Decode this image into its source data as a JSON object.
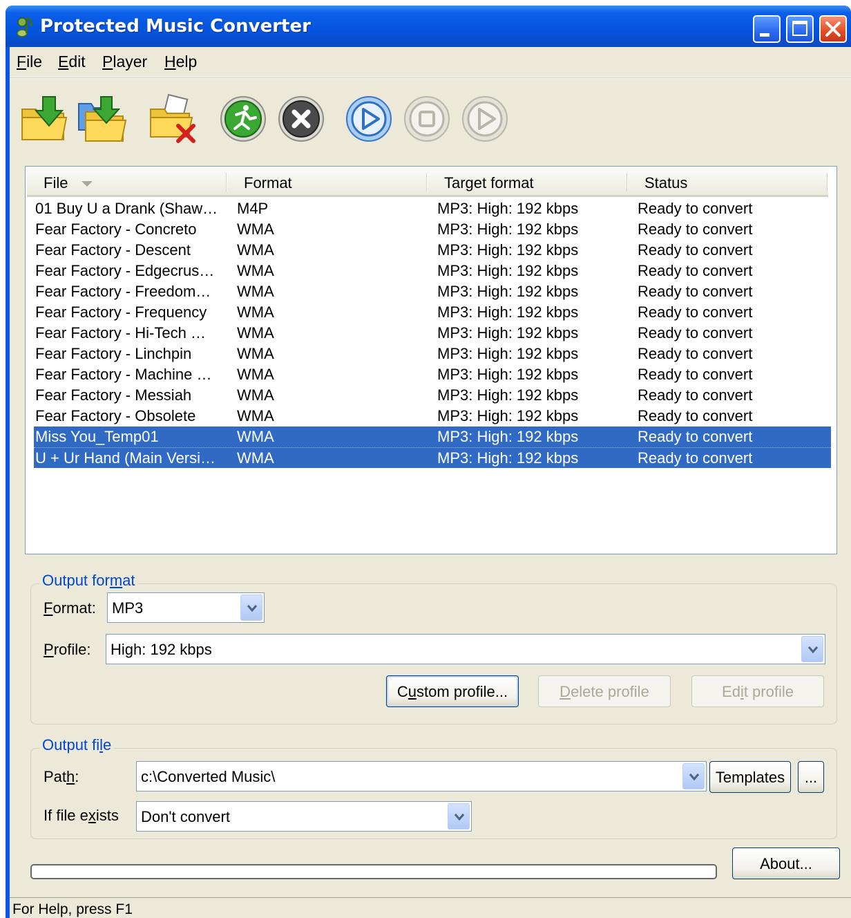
{
  "window": {
    "title": "Protected Music Converter"
  },
  "menu": [
    {
      "mnemonic": "F",
      "rest": "ile"
    },
    {
      "mnemonic": "E",
      "rest": "dit"
    },
    {
      "mnemonic": "P",
      "rest": "layer"
    },
    {
      "mnemonic": "H",
      "rest": "elp"
    }
  ],
  "toolbar": {
    "icons": [
      "add-files-icon",
      "add-folder-icon",
      "remove-files-icon",
      "convert-icon",
      "stop-convert-icon",
      "play-icon",
      "stop-icon",
      "next-icon"
    ]
  },
  "list": {
    "columns": [
      "File",
      "Format",
      "Target format",
      "Status"
    ],
    "rows": [
      {
        "file": "01 Buy U a Drank (Shaw…",
        "format": "M4P",
        "target": "MP3: High: 192 kbps",
        "status": "Ready to convert",
        "selected": false
      },
      {
        "file": "Fear Factory - Concreto",
        "format": "WMA",
        "target": "MP3: High: 192 kbps",
        "status": "Ready to convert",
        "selected": false
      },
      {
        "file": "Fear Factory - Descent",
        "format": "WMA",
        "target": "MP3: High: 192 kbps",
        "status": "Ready to convert",
        "selected": false
      },
      {
        "file": "Fear Factory - Edgecrus…",
        "format": "WMA",
        "target": "MP3: High: 192 kbps",
        "status": "Ready to convert",
        "selected": false
      },
      {
        "file": "Fear Factory - Freedom…",
        "format": "WMA",
        "target": "MP3: High: 192 kbps",
        "status": "Ready to convert",
        "selected": false
      },
      {
        "file": "Fear Factory - Frequency",
        "format": "WMA",
        "target": "MP3: High: 192 kbps",
        "status": "Ready to convert",
        "selected": false
      },
      {
        "file": "Fear Factory - Hi-Tech …",
        "format": "WMA",
        "target": "MP3: High: 192 kbps",
        "status": "Ready to convert",
        "selected": false
      },
      {
        "file": "Fear Factory - Linchpin",
        "format": "WMA",
        "target": "MP3: High: 192 kbps",
        "status": "Ready to convert",
        "selected": false
      },
      {
        "file": "Fear Factory - Machine …",
        "format": "WMA",
        "target": "MP3: High: 192 kbps",
        "status": "Ready to convert",
        "selected": false
      },
      {
        "file": "Fear Factory - Messiah",
        "format": "WMA",
        "target": "MP3: High: 192 kbps",
        "status": "Ready to convert",
        "selected": false
      },
      {
        "file": "Fear Factory - Obsolete",
        "format": "WMA",
        "target": "MP3: High: 192 kbps",
        "status": "Ready to convert",
        "selected": false
      },
      {
        "file": "Miss You_Temp01",
        "format": "WMA",
        "target": "MP3: High: 192 kbps",
        "status": "Ready to convert",
        "selected": true
      },
      {
        "file": "U + Ur Hand (Main Versi…",
        "format": "WMA",
        "target": "MP3: High: 192 kbps",
        "status": "Ready to convert",
        "selected": true
      }
    ]
  },
  "output_format": {
    "title_pre": "Output for",
    "title_mn": "m",
    "title_post": "at",
    "format_label_mn": "F",
    "format_label_rest": "ormat:",
    "format_value": "MP3",
    "profile_label_mn": "P",
    "profile_label_rest": "rofile:",
    "profile_value": "High: 192 kbps",
    "custom_pre": "C",
    "custom_mn": "u",
    "custom_post": "stom profile...",
    "delete_mn": "D",
    "delete_rest": "elete profile",
    "edit_pre": "Ed",
    "edit_mn": "i",
    "edit_post": "t profile"
  },
  "output_file": {
    "title_pre": "Output fi",
    "title_mn": "l",
    "title_post": "e",
    "path_pre": "Pat",
    "path_mn": "h",
    "path_post": ":",
    "path_value": "c:\\Converted Music\\",
    "templates_label": "Templates",
    "browse_label": "...",
    "exists_pre": "If file e",
    "exists_mn": "x",
    "exists_post": "ists",
    "exists_value": "Don't convert"
  },
  "about_label": "About...",
  "progress": {
    "fraction": 0
  },
  "status": {
    "text": "For Help, press F1"
  },
  "colors": {
    "titlebar": "#0554de",
    "selection": "#316ac5",
    "group_title": "#0046d5",
    "face": "#ece9d8"
  }
}
